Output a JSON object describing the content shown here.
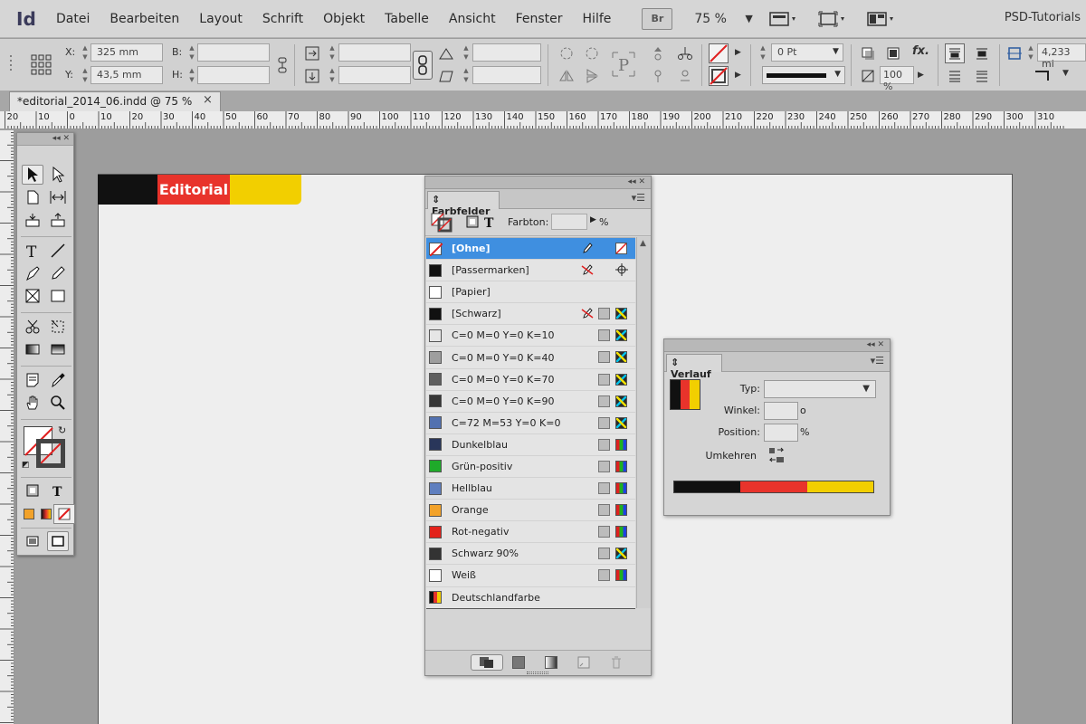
{
  "app": {
    "logo": "Id",
    "menu": [
      "Datei",
      "Bearbeiten",
      "Layout",
      "Schrift",
      "Objekt",
      "Tabelle",
      "Ansicht",
      "Fenster",
      "Hilfe"
    ],
    "bridge_label": "Br",
    "zoom": "75 %",
    "workspace_title": "PSD-Tutorials"
  },
  "control": {
    "x_label": "X:",
    "x_value": "325 mm",
    "y_label": "Y:",
    "y_value": "43,5 mm",
    "w_label": "B:",
    "h_label": "H:",
    "stroke_weight": "0 Pt",
    "opacity": "100 %",
    "fx_label": "fx.",
    "gap_value": "4,233 mi"
  },
  "document": {
    "tab_title": "*editorial_2014_06.indd @ 75 %",
    "close_glyph": "×",
    "banner_text": "Editorial"
  },
  "rulers": {
    "top": [
      "20",
      "10",
      "0",
      "10",
      "20",
      "30",
      "40",
      "50",
      "60",
      "70",
      "80",
      "90",
      "100",
      "110",
      "120",
      "130",
      "140",
      "150",
      "160",
      "170",
      "180",
      "190",
      "200",
      "210",
      "220",
      "230",
      "240",
      "250",
      "260",
      "270",
      "280",
      "290",
      "300",
      "310"
    ]
  },
  "swatches_panel": {
    "title": "Farbfelder",
    "tint_label": "Farbton:",
    "tint_unit": "%",
    "items": [
      {
        "name": "[Ohne]",
        "color": "#ffffff",
        "selected": true,
        "mark": "pencil-edit",
        "kind": "none"
      },
      {
        "name": "[Passermarken]",
        "color": "#111111",
        "mark": "no-edit",
        "kind": "registration"
      },
      {
        "name": "[Papier]",
        "color": "#ffffff",
        "kind": ""
      },
      {
        "name": "[Schwarz]",
        "color": "#111111",
        "mark": "no-edit",
        "kind": "process"
      },
      {
        "name": "C=0 M=0 Y=0 K=10",
        "color": "#e6e6e6",
        "kind": "process"
      },
      {
        "name": "C=0 M=0 Y=0 K=40",
        "color": "#9e9e9e",
        "kind": "process"
      },
      {
        "name": "C=0 M=0 Y=0 K=70",
        "color": "#5f5f5f",
        "kind": "process"
      },
      {
        "name": "C=0 M=0 Y=0 K=90",
        "color": "#353535",
        "kind": "process"
      },
      {
        "name": "C=72 M=53 Y=0 K=0",
        "color": "#5271b0",
        "kind": "process"
      },
      {
        "name": "Dunkelblau",
        "color": "#29365a",
        "kind": "rgb"
      },
      {
        "name": "Grün-positiv",
        "color": "#1faa2a",
        "kind": "rgb"
      },
      {
        "name": "Hellblau",
        "color": "#5f7fbf",
        "kind": "rgb"
      },
      {
        "name": "Orange",
        "color": "#f2a22a",
        "kind": "rgb"
      },
      {
        "name": "Rot-negativ",
        "color": "#e3221b",
        "kind": "rgb"
      },
      {
        "name": "Schwarz 90%",
        "color": "#333333",
        "kind": "process"
      },
      {
        "name": "Weiß",
        "color": "#ffffff",
        "kind": "rgb"
      },
      {
        "name": "Deutschlandfarbe",
        "color": "gradient",
        "kind": ""
      }
    ]
  },
  "gradient_panel": {
    "title": "Verlauf",
    "type_label": "Typ:",
    "angle_label": "Winkel:",
    "angle_unit": "o",
    "position_label": "Position:",
    "position_unit": "%",
    "reverse_label": "Umkehren",
    "stops": [
      "#111111",
      "#e8332b",
      "#f2cf00"
    ]
  },
  "colors": {
    "selection": "#3f8fe0",
    "flag_black": "#111111",
    "flag_red": "#e8332b",
    "flag_gold": "#f2cf00"
  }
}
